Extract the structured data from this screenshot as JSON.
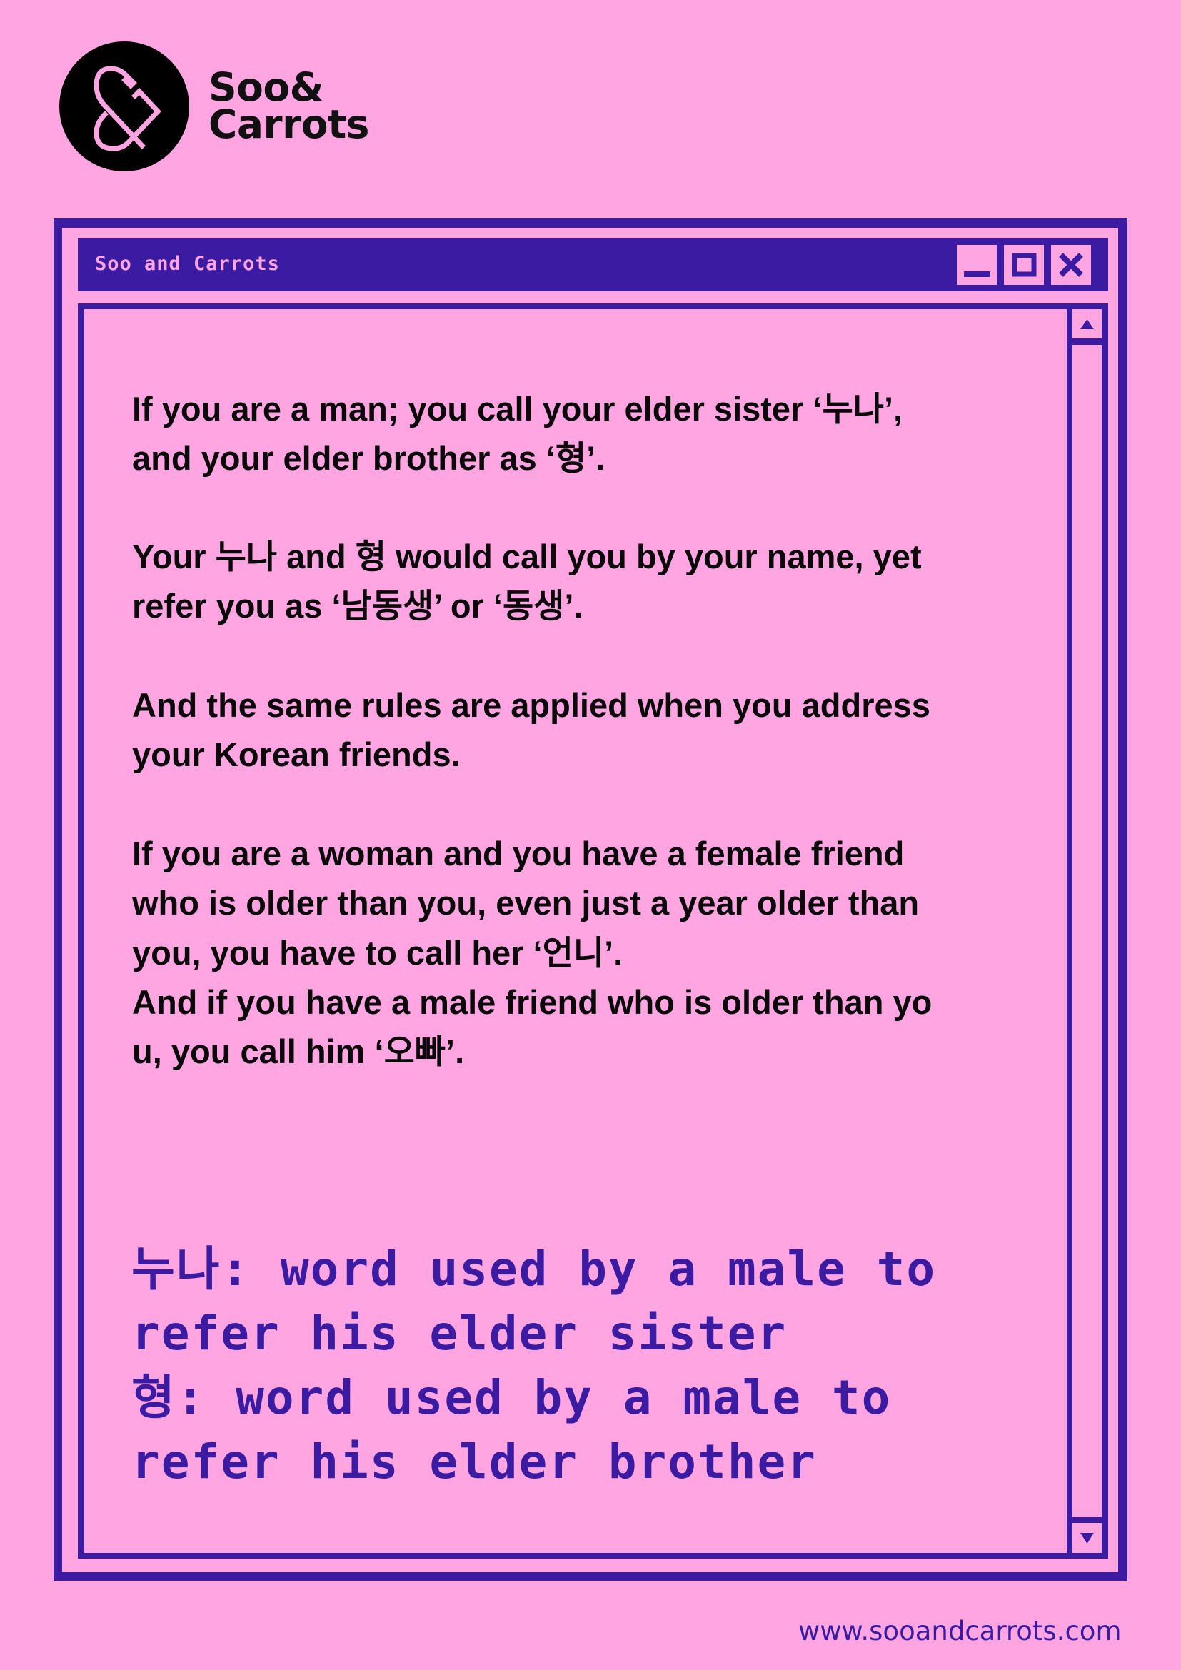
{
  "brand": {
    "logo_icon": "ampersand-logo-icon",
    "name_line1": "Soo&",
    "name_line2": "Carrots"
  },
  "window": {
    "title": "Soo and Carrots",
    "controls": {
      "minimize_icon": "minimize-icon",
      "maximize_icon": "maximize-icon",
      "close_icon": "close-icon"
    },
    "scrollbar": {
      "up_icon": "triangle-up-icon",
      "down_icon": "triangle-down-icon"
    }
  },
  "content": {
    "lines": [
      "If you are a man; you call your elder sister ‘누나’,",
      "and your elder brother as ‘형’.",
      "",
      "Your 누나 and 형 would call you by your name, yet",
      "refer you as ‘남동생’ or ‘동생’.",
      "",
      "And the same rules are applied when you address",
      "your Korean friends.",
      "",
      "If you are a woman and you have a female friend",
      "who is older than you, even just a year older than",
      "you, you have to call her ‘언니’.",
      "And if you have a male friend who is older than yo",
      "u, you call him ‘오빠’."
    ],
    "definitions": [
      "누나: word used by a male to",
      "refer his elder sister",
      "형: word used by a male to",
      "refer his elder brother"
    ]
  },
  "footer": {
    "url": "www.sooandcarrots.com"
  },
  "colors": {
    "background": "#ffa6e2",
    "accent": "#3a1ba1",
    "text": "#0a0a0a"
  }
}
